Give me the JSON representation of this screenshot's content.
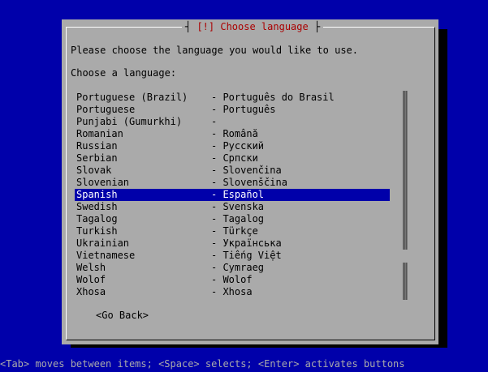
{
  "dialog": {
    "title": "[!] Choose language",
    "prompt": "Please choose the language you would like to use.",
    "list_label": "Choose a language:",
    "languages": [
      {
        "name": "Portuguese (Brazil)",
        "native": "- Português do Brasil"
      },
      {
        "name": "Portuguese",
        "native": "- Português"
      },
      {
        "name": "Punjabi (Gumurkhi)",
        "native": "-"
      },
      {
        "name": "Romanian",
        "native": "- Română"
      },
      {
        "name": "Russian",
        "native": "- Русский"
      },
      {
        "name": "Serbian",
        "native": "- Српски"
      },
      {
        "name": "Slovak",
        "native": "- Slovenčina"
      },
      {
        "name": "Slovenian",
        "native": "- Slovenščina"
      },
      {
        "name": "Spanish",
        "native": "- Español"
      },
      {
        "name": "Swedish",
        "native": "- Svenska"
      },
      {
        "name": "Tagalog",
        "native": "- Tagalog"
      },
      {
        "name": "Turkish",
        "native": "- Türkçe"
      },
      {
        "name": "Ukrainian",
        "native": "- Українська"
      },
      {
        "name": "Vietnamese",
        "native": "- Tiếng Việt"
      },
      {
        "name": "Welsh",
        "native": "- Cymraeg"
      },
      {
        "name": "Wolof",
        "native": "- Wolof"
      },
      {
        "name": "Xhosa",
        "native": "- Xhosa"
      }
    ],
    "selected_index": 8,
    "go_back_label": "<Go Back>"
  },
  "help_line": "<Tab> moves between items; <Space> selects; <Enter> activates buttons",
  "colors": {
    "screen_bg": "#0000aa",
    "dialog_bg": "#aaaaaa",
    "title_fg": "#aa0000",
    "selection_bg": "#0000aa",
    "selection_fg": "#ffffff"
  }
}
